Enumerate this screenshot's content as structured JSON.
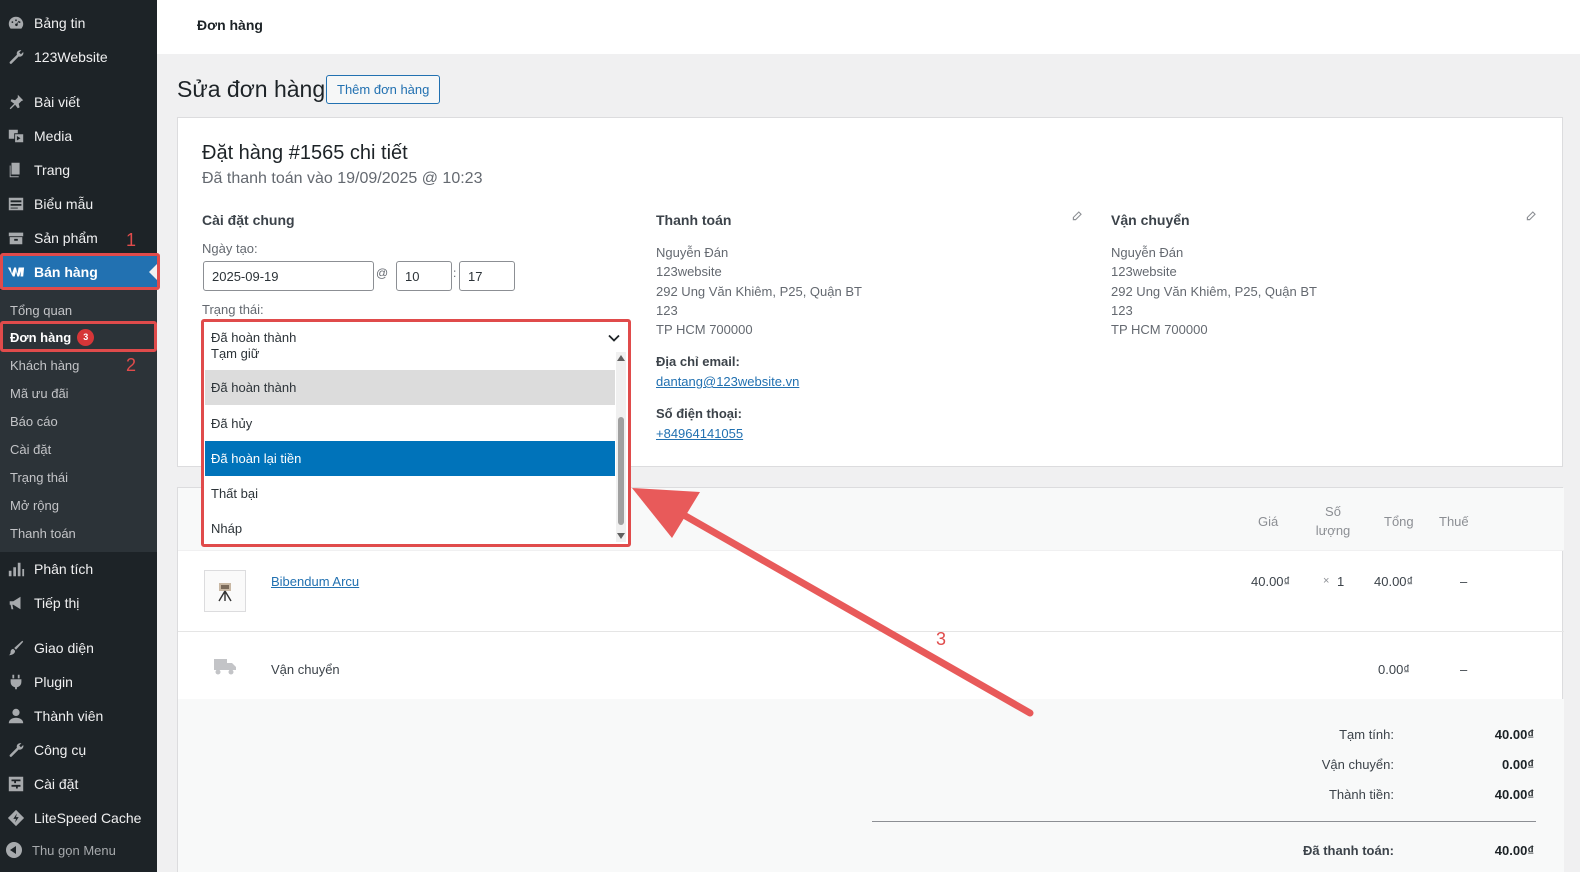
{
  "sidebar": {
    "items": [
      {
        "label": "Bảng tin",
        "icon": "dashboard-icon"
      },
      {
        "label": "123Website",
        "icon": "wrench-icon"
      },
      {
        "label": "Bài viết",
        "icon": "pin-icon"
      },
      {
        "label": "Media",
        "icon": "media-icon"
      },
      {
        "label": "Trang",
        "icon": "page-icon"
      },
      {
        "label": "Biểu mẫu",
        "icon": "form-icon"
      },
      {
        "label": "Sản phẩm",
        "icon": "archive-icon"
      },
      {
        "label": "Bán hàng",
        "icon": "woo-icon"
      },
      {
        "label": "Phân tích",
        "icon": "chart-icon"
      },
      {
        "label": "Tiếp thị",
        "icon": "megaphone-icon"
      },
      {
        "label": "Giao diện",
        "icon": "brush-icon"
      },
      {
        "label": "Plugin",
        "icon": "plugin-icon"
      },
      {
        "label": "Thành viên",
        "icon": "user-icon"
      },
      {
        "label": "Công cụ",
        "icon": "tools-icon"
      },
      {
        "label": "Cài đặt",
        "icon": "settings-icon"
      },
      {
        "label": "LiteSpeed Cache",
        "icon": "litespeed-icon"
      }
    ],
    "submenu": [
      "Tổng quan",
      "Đơn hàng",
      "Khách hàng",
      "Mã ưu đãi",
      "Báo cáo",
      "Cài đặt",
      "Trạng thái",
      "Mở rộng",
      "Thanh toán"
    ],
    "order_badge": "3",
    "collapse": "Thu gọn Menu"
  },
  "annotations": [
    "1",
    "2",
    "3"
  ],
  "topbar": {
    "breadcrumb": "Đơn hàng"
  },
  "page": {
    "title": "Sửa đơn hàng",
    "add_button": "Thêm đơn hàng"
  },
  "order": {
    "heading": "Đặt hàng #1565 chi tiết",
    "meta": "Đã thanh toán vào 19/09/2025 @ 10:23",
    "general": {
      "title": "Cài đặt chung",
      "date_label": "Ngày tạo:",
      "date": "2025-09-19",
      "at": "@",
      "hour": "10",
      "colon": ":",
      "minute": "17",
      "status_label": "Trạng thái:"
    },
    "billing": {
      "title": "Thanh toán",
      "lines": [
        "Nguyễn Đán",
        "123website",
        "292 Ung Văn Khiêm, P25, Quận BT",
        "123",
        "TP HCM 700000"
      ],
      "email_label": "Địa chỉ email:",
      "email": "dantang@123website.vn",
      "phone_label": "Số điện thoại:",
      "phone": "+84964141055"
    },
    "shipping": {
      "title": "Vận chuyển",
      "lines": [
        "Nguyễn Đán",
        "123website",
        "292 Ung Văn Khiêm, P25, Quận BT",
        "123",
        "TP HCM 700000"
      ]
    }
  },
  "status_dropdown": {
    "selected": "Đã hoàn thành",
    "options": [
      "Tạm giữ",
      "Đã hoàn thành",
      "Đã hủy",
      "Đã hoàn lại tiền",
      "Thất bại",
      "Nháp"
    ],
    "hovered": "Đã hoàn thành",
    "highlighted": "Đã hoàn lại tiền"
  },
  "items": {
    "headers": {
      "price": "Giá",
      "qty_1": "Số",
      "qty_2": "lượng",
      "total": "Tổng",
      "tax": "Thuế"
    },
    "product": {
      "name": "Bibendum Arcu",
      "price": "40.00₫",
      "qty_x": "×",
      "qty": "1",
      "total": "40.00₫",
      "tax": "–"
    },
    "shipping": {
      "name": "Vận chuyển",
      "total": "0.00₫",
      "tax": "–"
    },
    "totals": [
      {
        "label": "Tạm tính:",
        "value": "40.00₫"
      },
      {
        "label": "Vận chuyển:",
        "value": "0.00₫"
      },
      {
        "label": "Thành tiền:",
        "value": "40.00₫"
      }
    ],
    "paid": {
      "label": "Đã thanh toán:",
      "value": "40.00₫"
    }
  },
  "colors": {
    "sidebar": "#1d2327",
    "accent": "#2271b1",
    "annotation": "#e04b4b",
    "selected_option": "#0073ba"
  }
}
